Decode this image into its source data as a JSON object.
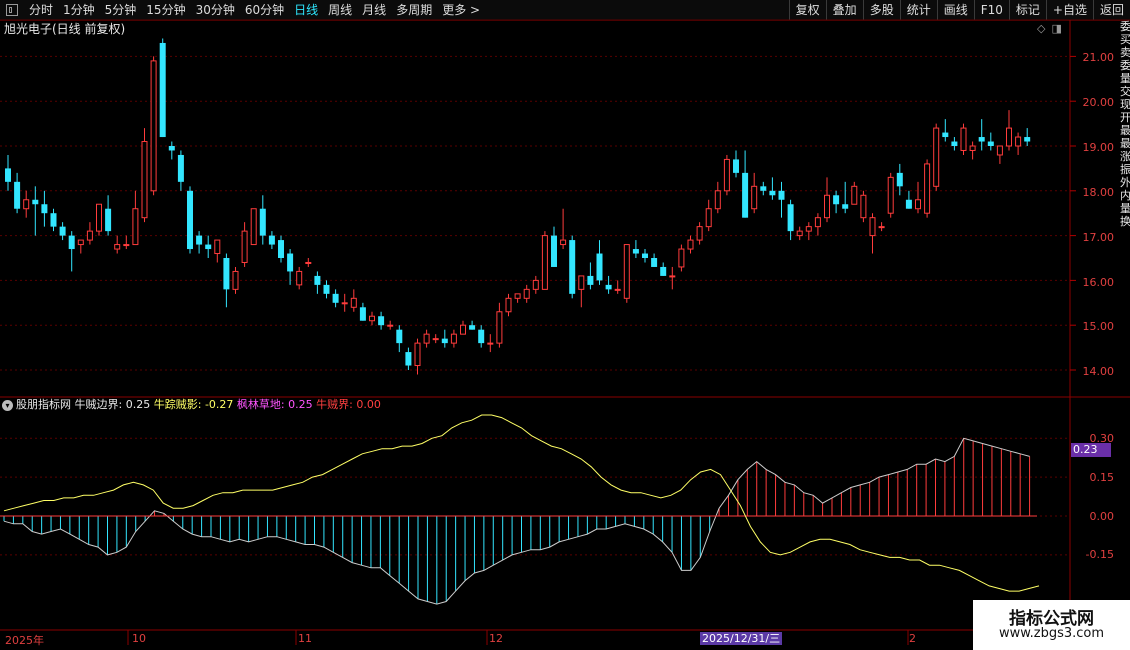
{
  "toolbar": {
    "periods": [
      "分时",
      "1分钟",
      "5分钟",
      "15分钟",
      "30分钟",
      "60分钟",
      "日线",
      "周线",
      "月线",
      "多周期",
      "更多 >"
    ],
    "active_period": "日线",
    "tools": [
      "复权",
      "叠加",
      "多股",
      "统计",
      "画线",
      "F10",
      "标记",
      "+自选",
      "返回"
    ]
  },
  "stock": {
    "title": "旭光电子(日线 前复权)"
  },
  "price_axis": [
    "21.00",
    "20.00",
    "19.00",
    "18.00",
    "17.00",
    "16.00",
    "15.00",
    "14.00"
  ],
  "indicator": {
    "name": "股朋指标网",
    "l1_label": "牛贼边界:",
    "l1_value": "0.25",
    "l2_label": "牛踪贼影:",
    "l2_value": "-0.27",
    "l3_label": "枫林草地:",
    "l3_value": "0.25",
    "l4_label": "牛贼界:",
    "l4_value": "0.00",
    "badge": "0.23",
    "axis": [
      "0.30",
      "0.15",
      "0.00",
      "-0.15"
    ]
  },
  "dates": {
    "d1": "2025年",
    "d2": "10",
    "d3": "11",
    "d4": "12",
    "d5": "2025/12/31/三",
    "d6": "2"
  },
  "watermark": {
    "title": "指标公式网",
    "url": "www.zbgs3.com"
  },
  "right_strip": "委买卖委量交现开最最涨振外内量换",
  "colors": {
    "up": "#ff3c3c",
    "down": "#33e6ff",
    "line": "#ffff66",
    "grid": "#5a0000"
  },
  "chart_data": {
    "type": "candlestick",
    "series_ohlc": [
      [
        18.5,
        18.8,
        18.0,
        18.2
      ],
      [
        18.2,
        18.4,
        17.5,
        17.6
      ],
      [
        17.6,
        18.0,
        17.4,
        17.8
      ],
      [
        17.8,
        18.1,
        17.0,
        17.7
      ],
      [
        17.7,
        18.0,
        17.2,
        17.5
      ],
      [
        17.5,
        17.6,
        17.1,
        17.2
      ],
      [
        17.2,
        17.3,
        16.9,
        17.0
      ],
      [
        17.0,
        17.1,
        16.2,
        16.7
      ],
      [
        16.8,
        16.9,
        16.6,
        16.9
      ],
      [
        16.9,
        17.3,
        16.8,
        17.1
      ],
      [
        17.1,
        17.7,
        17.0,
        17.7
      ],
      [
        17.6,
        17.9,
        17.0,
        17.1
      ],
      [
        16.7,
        17.0,
        16.6,
        16.8
      ],
      [
        16.8,
        17.0,
        16.7,
        16.8
      ],
      [
        16.8,
        18.0,
        16.8,
        17.6
      ],
      [
        17.4,
        19.4,
        17.3,
        19.1
      ],
      [
        18.0,
        21.0,
        17.9,
        20.9
      ],
      [
        21.3,
        21.4,
        19.2,
        19.2
      ],
      [
        19.0,
        19.1,
        18.7,
        18.9
      ],
      [
        18.8,
        18.9,
        18.0,
        18.2
      ],
      [
        18.0,
        18.1,
        16.6,
        16.7
      ],
      [
        17.0,
        17.1,
        16.6,
        16.8
      ],
      [
        16.8,
        17.0,
        16.5,
        16.7
      ],
      [
        16.6,
        16.9,
        16.4,
        16.9
      ],
      [
        16.5,
        16.6,
        15.4,
        15.8
      ],
      [
        15.8,
        16.3,
        15.7,
        16.2
      ],
      [
        16.4,
        17.3,
        16.3,
        17.1
      ],
      [
        16.8,
        17.6,
        16.8,
        17.6
      ],
      [
        17.6,
        17.9,
        16.8,
        17.0
      ],
      [
        17.0,
        17.1,
        16.7,
        16.8
      ],
      [
        16.9,
        17.0,
        16.4,
        16.5
      ],
      [
        16.6,
        16.7,
        15.9,
        16.2
      ],
      [
        15.9,
        16.3,
        15.8,
        16.2
      ],
      [
        16.4,
        16.5,
        16.3,
        16.4
      ],
      [
        16.1,
        16.2,
        15.7,
        15.9
      ],
      [
        15.9,
        16.0,
        15.6,
        15.7
      ],
      [
        15.7,
        15.8,
        15.4,
        15.5
      ],
      [
        15.5,
        15.7,
        15.3,
        15.5
      ],
      [
        15.4,
        15.8,
        15.3,
        15.6
      ],
      [
        15.4,
        15.5,
        15.1,
        15.1
      ],
      [
        15.1,
        15.3,
        15.0,
        15.2
      ],
      [
        15.2,
        15.3,
        14.9,
        15.0
      ],
      [
        15.0,
        15.1,
        14.9,
        15.0
      ],
      [
        14.9,
        15.0,
        14.4,
        14.6
      ],
      [
        14.4,
        14.5,
        14.0,
        14.1
      ],
      [
        14.1,
        14.7,
        13.9,
        14.6
      ],
      [
        14.6,
        14.9,
        14.5,
        14.8
      ],
      [
        14.7,
        14.8,
        14.6,
        14.7
      ],
      [
        14.7,
        14.9,
        14.5,
        14.6
      ],
      [
        14.6,
        14.9,
        14.5,
        14.8
      ],
      [
        14.8,
        15.1,
        14.8,
        15.0
      ],
      [
        15.0,
        15.1,
        14.9,
        14.9
      ],
      [
        14.9,
        15.0,
        14.5,
        14.6
      ],
      [
        14.6,
        14.8,
        14.4,
        14.6
      ],
      [
        14.6,
        15.5,
        14.5,
        15.3
      ],
      [
        15.3,
        15.7,
        15.2,
        15.6
      ],
      [
        15.6,
        15.7,
        15.5,
        15.7
      ],
      [
        15.6,
        15.9,
        15.5,
        15.8
      ],
      [
        15.8,
        16.1,
        15.7,
        16.0
      ],
      [
        15.8,
        17.1,
        15.8,
        17.0
      ],
      [
        17.0,
        17.2,
        16.3,
        16.3
      ],
      [
        16.8,
        17.6,
        16.7,
        16.9
      ],
      [
        16.9,
        17.0,
        15.6,
        15.7
      ],
      [
        15.8,
        16.1,
        15.4,
        16.1
      ],
      [
        16.1,
        16.4,
        15.8,
        15.9
      ],
      [
        16.6,
        16.9,
        15.9,
        16.0
      ],
      [
        15.9,
        16.1,
        15.7,
        15.8
      ],
      [
        15.8,
        16.0,
        15.7,
        15.8
      ],
      [
        15.6,
        16.8,
        15.5,
        16.8
      ],
      [
        16.7,
        16.9,
        16.5,
        16.6
      ],
      [
        16.6,
        16.7,
        16.4,
        16.5
      ],
      [
        16.5,
        16.6,
        16.3,
        16.3
      ],
      [
        16.3,
        16.4,
        16.1,
        16.1
      ],
      [
        16.1,
        16.3,
        15.8,
        16.1
      ],
      [
        16.3,
        16.8,
        16.2,
        16.7
      ],
      [
        16.7,
        17.0,
        16.6,
        16.9
      ],
      [
        16.9,
        17.3,
        16.8,
        17.2
      ],
      [
        17.2,
        17.8,
        17.1,
        17.6
      ],
      [
        17.6,
        18.2,
        17.5,
        18.0
      ],
      [
        18.0,
        18.8,
        17.9,
        18.7
      ],
      [
        18.7,
        18.9,
        18.3,
        18.4
      ],
      [
        18.4,
        18.9,
        17.4,
        17.4
      ],
      [
        17.6,
        18.4,
        17.5,
        18.1
      ],
      [
        18.1,
        18.2,
        17.9,
        18.0
      ],
      [
        18.0,
        18.3,
        17.8,
        17.9
      ],
      [
        18.0,
        18.2,
        17.4,
        17.8
      ],
      [
        17.7,
        17.8,
        16.9,
        17.1
      ],
      [
        17.0,
        17.2,
        16.9,
        17.1
      ],
      [
        17.1,
        17.3,
        16.9,
        17.2
      ],
      [
        17.2,
        17.5,
        17.0,
        17.4
      ],
      [
        17.4,
        18.3,
        17.3,
        17.9
      ],
      [
        17.9,
        18.0,
        17.5,
        17.7
      ],
      [
        17.7,
        18.2,
        17.5,
        17.6
      ],
      [
        17.7,
        18.2,
        17.7,
        18.1
      ],
      [
        17.4,
        18.0,
        17.3,
        17.9
      ],
      [
        17.0,
        17.5,
        16.6,
        17.4
      ],
      [
        17.2,
        17.3,
        17.1,
        17.2
      ],
      [
        17.5,
        18.4,
        17.4,
        18.3
      ],
      [
        18.4,
        18.6,
        17.9,
        18.1
      ],
      [
        17.8,
        18.0,
        17.6,
        17.6
      ],
      [
        17.6,
        18.2,
        17.5,
        17.8
      ],
      [
        17.5,
        18.7,
        17.4,
        18.6
      ],
      [
        18.1,
        19.5,
        18.0,
        19.4
      ],
      [
        19.3,
        19.6,
        19.1,
        19.2
      ],
      [
        19.1,
        19.2,
        18.9,
        19.0
      ],
      [
        18.9,
        19.5,
        18.8,
        19.4
      ],
      [
        18.9,
        19.1,
        18.7,
        19.0
      ],
      [
        19.2,
        19.6,
        18.9,
        19.1
      ],
      [
        19.1,
        19.3,
        18.9,
        19.0
      ],
      [
        18.8,
        19.0,
        18.6,
        19.0
      ],
      [
        19.0,
        19.8,
        18.9,
        19.4
      ],
      [
        19.0,
        19.3,
        18.8,
        19.2
      ],
      [
        19.2,
        19.4,
        19.0,
        19.1
      ]
    ],
    "indicator_bars": [
      -0.02,
      -0.03,
      -0.03,
      -0.06,
      -0.07,
      -0.06,
      -0.05,
      -0.07,
      -0.09,
      -0.11,
      -0.12,
      -0.15,
      -0.14,
      -0.12,
      -0.06,
      -0.02,
      0.02,
      0.01,
      -0.02,
      -0.05,
      -0.07,
      -0.08,
      -0.08,
      -0.09,
      -0.1,
      -0.09,
      -0.1,
      -0.09,
      -0.08,
      -0.08,
      -0.09,
      -0.1,
      -0.11,
      -0.11,
      -0.12,
      -0.14,
      -0.16,
      -0.18,
      -0.19,
      -0.2,
      -0.2,
      -0.23,
      -0.26,
      -0.29,
      -0.32,
      -0.33,
      -0.34,
      -0.33,
      -0.29,
      -0.25,
      -0.22,
      -0.21,
      -0.19,
      -0.17,
      -0.15,
      -0.14,
      -0.13,
      -0.13,
      -0.12,
      -0.1,
      -0.09,
      -0.08,
      -0.07,
      -0.05,
      -0.05,
      -0.04,
      -0.03,
      -0.04,
      -0.05,
      -0.07,
      -0.1,
      -0.14,
      -0.21,
      -0.21,
      -0.16,
      -0.06,
      0.03,
      0.08,
      0.14,
      0.18,
      0.21,
      0.18,
      0.16,
      0.13,
      0.12,
      0.09,
      0.08,
      0.05,
      0.07,
      0.09,
      0.11,
      0.12,
      0.13,
      0.15,
      0.16,
      0.17,
      0.18,
      0.2,
      0.2,
      0.22,
      0.21,
      0.23,
      0.3,
      0.29,
      0.28,
      0.27,
      0.26,
      0.25,
      0.24,
      0.23
    ],
    "indicator_line": [
      0.02,
      0.03,
      0.04,
      0.05,
      0.06,
      0.06,
      0.07,
      0.07,
      0.08,
      0.08,
      0.09,
      0.1,
      0.12,
      0.13,
      0.12,
      0.1,
      0.05,
      0.03,
      0.03,
      0.04,
      0.06,
      0.08,
      0.09,
      0.09,
      0.1,
      0.1,
      0.1,
      0.1,
      0.11,
      0.12,
      0.13,
      0.15,
      0.16,
      0.18,
      0.2,
      0.22,
      0.24,
      0.25,
      0.26,
      0.26,
      0.27,
      0.27,
      0.28,
      0.3,
      0.31,
      0.34,
      0.36,
      0.37,
      0.39,
      0.39,
      0.38,
      0.36,
      0.34,
      0.31,
      0.29,
      0.27,
      0.26,
      0.24,
      0.22,
      0.19,
      0.15,
      0.12,
      0.1,
      0.09,
      0.09,
      0.08,
      0.07,
      0.08,
      0.1,
      0.14,
      0.17,
      0.18,
      0.16,
      0.1,
      0.04,
      -0.04,
      -0.1,
      -0.14,
      -0.15,
      -0.14,
      -0.12,
      -0.1,
      -0.09,
      -0.09,
      -0.1,
      -0.11,
      -0.13,
      -0.14,
      -0.15,
      -0.16,
      -0.16,
      -0.17,
      -0.17,
      -0.19,
      -0.19,
      -0.2,
      -0.21,
      -0.23,
      -0.25,
      -0.27,
      -0.28,
      -0.29,
      -0.29,
      -0.28,
      -0.27
    ]
  }
}
